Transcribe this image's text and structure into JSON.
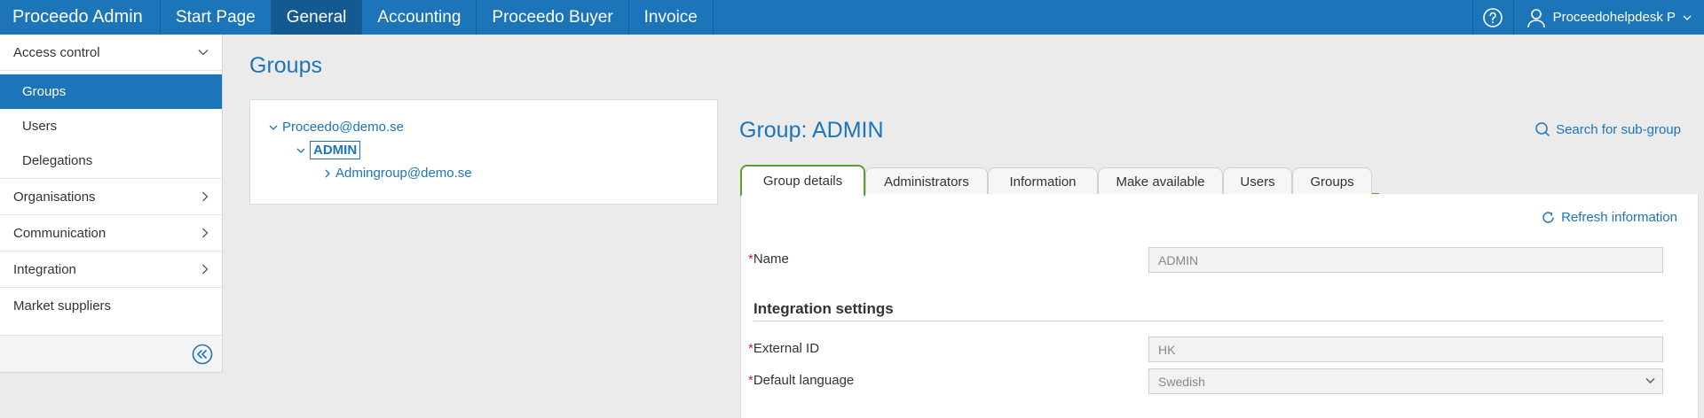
{
  "topbar": {
    "brand": "Proceedo Admin",
    "nav": [
      {
        "label": "Start Page",
        "active": false
      },
      {
        "label": "General",
        "active": true
      },
      {
        "label": "Accounting",
        "active": false
      },
      {
        "label": "Proceedo Buyer",
        "active": false
      },
      {
        "label": "Invoice",
        "active": false
      }
    ],
    "help_icon": "question-circle-icon",
    "user_label": "Proceedohelpdesk P",
    "user_icon": "user-icon"
  },
  "sidebar": {
    "section": "Access control",
    "sub_items": [
      {
        "label": "Groups",
        "active": true
      },
      {
        "label": "Users",
        "active": false
      },
      {
        "label": "Delegations",
        "active": false
      }
    ],
    "items": [
      {
        "label": "Organisations"
      },
      {
        "label": "Communication"
      },
      {
        "label": "Integration"
      },
      {
        "label": "Market suppliers"
      }
    ],
    "collapse_icon": "double-chevron-left-icon"
  },
  "main": {
    "title": "Groups",
    "tree": {
      "root": "Proceedo@demo.se",
      "selected": "ADMIN",
      "child": "Admingroup@demo.se"
    },
    "group_title": "Group: ADMIN",
    "search_subgroup": "Search for sub-group",
    "tabs": [
      "Group details",
      "Administrators",
      "Information",
      "Make available",
      "Users",
      "Groups"
    ],
    "active_tab": "Group details",
    "refresh": "Refresh information",
    "required_mark": "*",
    "fields": {
      "name_label": "Name",
      "name_value": "ADMIN",
      "section": "Integration settings",
      "external_id_label": "External ID",
      "external_id_value": "HK",
      "language_label": "Default language",
      "language_value": "Swedish"
    }
  },
  "colors": {
    "accent": "#1c75b9",
    "tab_active_border": "#5aa02c",
    "required": "#c0262d"
  }
}
